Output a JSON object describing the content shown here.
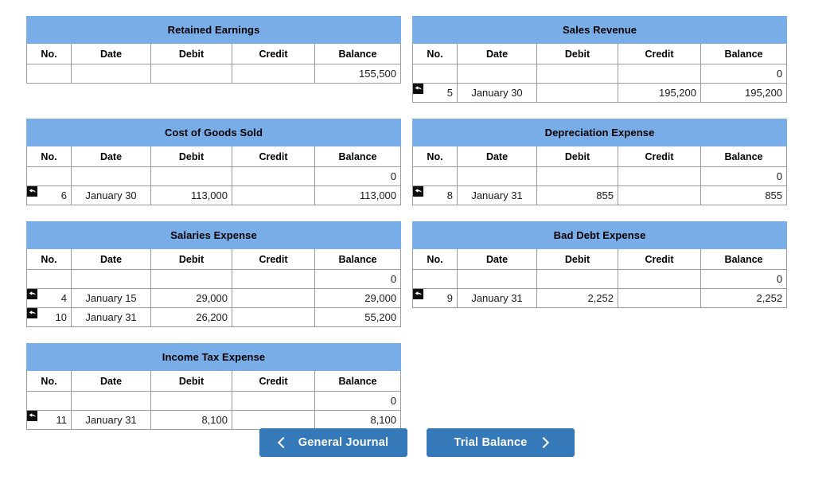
{
  "columns": [
    "No.",
    "Date",
    "Debit",
    "Credit",
    "Balance"
  ],
  "accounts": [
    {
      "title": "Retained Earnings",
      "rows": [
        {
          "icon": "",
          "no": "",
          "date": "",
          "debit": "",
          "credit": "",
          "balance": "155,500"
        }
      ]
    },
    {
      "title": "Sales Revenue",
      "rows": [
        {
          "icon": "",
          "no": "",
          "date": "",
          "debit": "",
          "credit": "",
          "balance": "0"
        },
        {
          "icon": "undo-arrow-icon",
          "no": "5",
          "date": "January 30",
          "debit": "",
          "credit": "195,200",
          "balance": "195,200"
        }
      ]
    },
    {
      "title": "Cost of Goods Sold",
      "rows": [
        {
          "icon": "",
          "no": "",
          "date": "",
          "debit": "",
          "credit": "",
          "balance": "0"
        },
        {
          "icon": "undo-arrow-icon",
          "no": "6",
          "date": "January 30",
          "debit": "113,000",
          "credit": "",
          "balance": "113,000"
        }
      ]
    },
    {
      "title": "Depreciation Expense",
      "rows": [
        {
          "icon": "",
          "no": "",
          "date": "",
          "debit": "",
          "credit": "",
          "balance": "0"
        },
        {
          "icon": "undo-arrow-icon",
          "no": "8",
          "date": "January 31",
          "debit": "855",
          "credit": "",
          "balance": "855"
        }
      ]
    },
    {
      "title": "Salaries Expense",
      "rows": [
        {
          "icon": "",
          "no": "",
          "date": "",
          "debit": "",
          "credit": "",
          "balance": "0"
        },
        {
          "icon": "undo-arrow-icon",
          "no": "4",
          "date": "January 15",
          "debit": "29,000",
          "credit": "",
          "balance": "29,000"
        },
        {
          "icon": "undo-arrow-icon",
          "no": "10",
          "date": "January 31",
          "debit": "26,200",
          "credit": "",
          "balance": "55,200"
        }
      ]
    },
    {
      "title": "Bad Debt Expense",
      "rows": [
        {
          "icon": "",
          "no": "",
          "date": "",
          "debit": "",
          "credit": "",
          "balance": "0"
        },
        {
          "icon": "undo-arrow-icon",
          "no": "9",
          "date": "January 31",
          "debit": "2,252",
          "credit": "",
          "balance": "2,252"
        }
      ]
    },
    {
      "title": "Income Tax Expense",
      "rows": [
        {
          "icon": "",
          "no": "",
          "date": "",
          "debit": "",
          "credit": "",
          "balance": "0"
        },
        {
          "icon": "undo-arrow-icon",
          "no": "11",
          "date": "January 31",
          "debit": "8,100",
          "credit": "",
          "balance": "8,100"
        }
      ]
    }
  ],
  "footer": {
    "prev_label": "General Journal",
    "prev_icon": "chevron-left-icon",
    "next_label": "Trial Balance",
    "next_icon": "chevron-right-icon"
  },
  "colors": {
    "account_header_blue": "#79ADE8",
    "button_blue": "#3579B8",
    "grid_line": "#9A9A9A",
    "text": "#1A1A1A"
  }
}
